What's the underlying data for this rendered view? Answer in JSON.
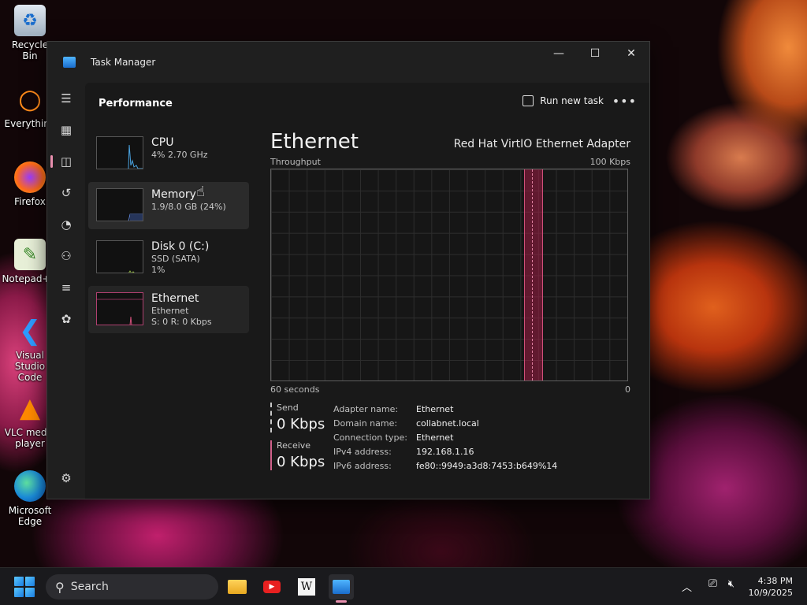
{
  "desktop": {
    "icons": [
      {
        "label": "Recycle Bin",
        "icon": "recycle-bin-icon"
      },
      {
        "label": "Everything",
        "icon": "everything-search-icon"
      },
      {
        "label": "Firefox",
        "icon": "firefox-icon"
      },
      {
        "label": "Notepad++",
        "icon": "notepad-plus-plus-icon"
      },
      {
        "label": "Visual Studio Code",
        "icon": "vscode-icon"
      },
      {
        "label": "VLC media player",
        "icon": "vlc-icon"
      },
      {
        "label": "Microsoft Edge",
        "icon": "edge-icon"
      }
    ]
  },
  "window": {
    "title": "Task Manager",
    "controls": {
      "minimize": "—",
      "maximize": "☐",
      "close": "✕"
    }
  },
  "rail": {
    "items": [
      "hamburger-menu-icon",
      "processes-icon",
      "performance-icon",
      "app-history-icon",
      "startup-apps-icon",
      "users-icon",
      "details-icon",
      "services-icon"
    ],
    "settings": "settings-icon"
  },
  "header": {
    "page_title": "Performance",
    "run_task_label": "Run new task",
    "more_label": "•••"
  },
  "perf_list": [
    {
      "name": "CPU",
      "line1": "4% 2.70 GHz",
      "line2": ""
    },
    {
      "name": "Memory",
      "line1": "1.9/8.0 GB (24%)",
      "line2": ""
    },
    {
      "name": "Disk 0 (C:)",
      "line1": "SSD (SATA)",
      "line2": "1%"
    },
    {
      "name": "Ethernet",
      "line1": "Ethernet",
      "line2": "S: 0 R: 0 Kbps"
    }
  ],
  "detail": {
    "title": "Ethernet",
    "adapter": "Red Hat VirtIO Ethernet Adapter",
    "y_label": "Throughput",
    "y_max": "100 Kbps",
    "x_left": "60 seconds",
    "x_right": "0",
    "send_label": "Send",
    "send_value": "0 Kbps",
    "receive_label": "Receive",
    "receive_value": "0 Kbps",
    "properties": [
      {
        "key": "Adapter name:",
        "value": "Ethernet"
      },
      {
        "key": "Domain name:",
        "value": "collabnet.local"
      },
      {
        "key": "Connection type:",
        "value": "Ethernet"
      },
      {
        "key": "IPv4 address:",
        "value": "192.168.1.16"
      },
      {
        "key": "IPv6 address:",
        "value": "fe80::9949:a3d8:7453:b649%14"
      }
    ]
  },
  "taskbar": {
    "search_placeholder": "Search",
    "apps": [
      "file-explorer-icon",
      "youtube-icon",
      "wikipedia-icon",
      "task-manager-icon"
    ],
    "time": "4:38 PM",
    "date": "10/9/2025"
  },
  "colors": {
    "accent": "#e88fae",
    "graph_line": "#d0507a",
    "cpu_line": "#4aa3e0"
  }
}
